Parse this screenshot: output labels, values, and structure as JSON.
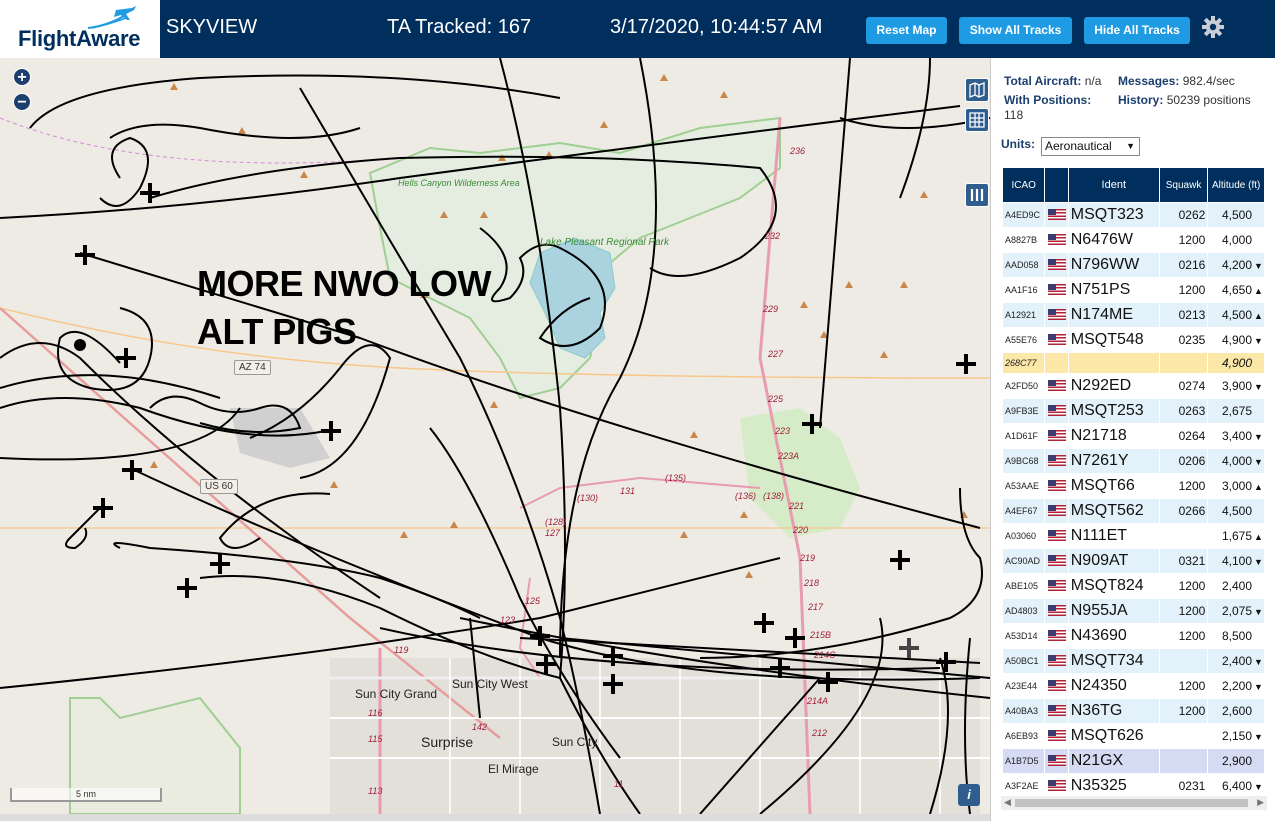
{
  "header": {
    "logo": "FlightAware",
    "title": "SKYVIEW",
    "tracked": "TA Tracked: 167",
    "datetime": "3/17/2020, 10:44:57 AM",
    "buttons": {
      "reset": "Reset Map",
      "show": "Show All Tracks",
      "hide": "Hide All Tracks"
    }
  },
  "map": {
    "annotation_line1": "MORE NWO LOW",
    "annotation_line2": "ALT PIGS",
    "scale": "5 nm",
    "labels": {
      "lake": "Lake Pleasant Regional Park",
      "wilderness": "Hells Canyon Wilderness Area",
      "az74": "AZ 74",
      "us60": "US 60",
      "sun_city_grand": "Sun City Grand",
      "sun_city_west": "Sun City West",
      "sun_city": "Sun City",
      "surprise": "Surprise",
      "el_mirage": "El Mirage"
    },
    "highway_numbers": [
      "236",
      "232",
      "229",
      "227",
      "225",
      "223",
      "223A",
      "221",
      "220",
      "219",
      "218",
      "217",
      "215B",
      "214A",
      "214C",
      "212",
      "(130)",
      "(135)",
      "(136)",
      "(138)",
      "(128)",
      "127",
      "125",
      "123",
      "131",
      "119",
      "116",
      "115",
      "113",
      "142",
      "11"
    ]
  },
  "panel": {
    "total_aircraft_label": "Total Aircraft:",
    "total_aircraft": "n/a",
    "messages_label": "Messages:",
    "messages": "982.4/sec",
    "with_positions_label": "With Positions:",
    "with_positions": "118",
    "history_label": "History:",
    "history": "50239 positions",
    "units_label": "Units:",
    "units_value": "Aeronautical",
    "columns": [
      "ICAO",
      "",
      "Ident",
      "Squawk",
      "Altitude (ft)"
    ],
    "rows": [
      {
        "icao": "A4ED9C",
        "ident": "MSQT323",
        "squawk": "0262",
        "alt": "4,500",
        "trend": ""
      },
      {
        "icao": "A8827B",
        "ident": "N6476W",
        "squawk": "1200",
        "alt": "4,000",
        "trend": ""
      },
      {
        "icao": "AAD058",
        "ident": "N796WW",
        "squawk": "0216",
        "alt": "4,200",
        "trend": "▼"
      },
      {
        "icao": "AA1F16",
        "ident": "N751PS",
        "squawk": "1200",
        "alt": "4,650",
        "trend": "▲"
      },
      {
        "icao": "A12921",
        "ident": "N174ME",
        "squawk": "0213",
        "alt": "4,500",
        "trend": "▲"
      },
      {
        "icao": "A55E76",
        "ident": "MSQT548",
        "squawk": "0235",
        "alt": "4,900",
        "trend": "▼"
      },
      {
        "icao": "268C77",
        "ident": "",
        "squawk": "",
        "alt": "4,900",
        "trend": ""
      },
      {
        "icao": "A2FD50",
        "ident": "N292ED",
        "squawk": "0274",
        "alt": "3,900",
        "trend": "▼"
      },
      {
        "icao": "A9FB3E",
        "ident": "MSQT253",
        "squawk": "0263",
        "alt": "2,675",
        "trend": ""
      },
      {
        "icao": "A1D61F",
        "ident": "N21718",
        "squawk": "0264",
        "alt": "3,400",
        "trend": "▼"
      },
      {
        "icao": "A9BC68",
        "ident": "N7261Y",
        "squawk": "0206",
        "alt": "4,000",
        "trend": "▼"
      },
      {
        "icao": "A53AAE",
        "ident": "MSQT66",
        "squawk": "1200",
        "alt": "3,000",
        "trend": "▲"
      },
      {
        "icao": "A4EF67",
        "ident": "MSQT562",
        "squawk": "0266",
        "alt": "4,500",
        "trend": ""
      },
      {
        "icao": "A03060",
        "ident": "N111ET",
        "squawk": "",
        "alt": "1,675",
        "trend": "▲"
      },
      {
        "icao": "AC90AD",
        "ident": "N909AT",
        "squawk": "0321",
        "alt": "4,100",
        "trend": "▼"
      },
      {
        "icao": "ABE105",
        "ident": "MSQT824",
        "squawk": "1200",
        "alt": "2,400",
        "trend": ""
      },
      {
        "icao": "AD4803",
        "ident": "N955JA",
        "squawk": "1200",
        "alt": "2,075",
        "trend": "▼"
      },
      {
        "icao": "A53D14",
        "ident": "N43690",
        "squawk": "1200",
        "alt": "8,500",
        "trend": ""
      },
      {
        "icao": "A50BC1",
        "ident": "MSQT734",
        "squawk": "",
        "alt": "2,400",
        "trend": "▼"
      },
      {
        "icao": "A23E44",
        "ident": "N24350",
        "squawk": "1200",
        "alt": "2,200",
        "trend": "▼"
      },
      {
        "icao": "A40BA3",
        "ident": "N36TG",
        "squawk": "1200",
        "alt": "2,600",
        "trend": ""
      },
      {
        "icao": "A6EB93",
        "ident": "MSQT626",
        "squawk": "",
        "alt": "2,150",
        "trend": "▼"
      },
      {
        "icao": "A1B7D5",
        "ident": "N21GX",
        "squawk": "",
        "alt": "2,900",
        "trend": ""
      },
      {
        "icao": "A3F2AE",
        "ident": "N35325",
        "squawk": "0231",
        "alt": "6,400",
        "trend": "▼"
      }
    ]
  },
  "colors": {
    "header_bg": "#002f5d",
    "button": "#1e9be3",
    "row_alt": "#e2f1fa",
    "highlight": "#fbe7a8",
    "selected": "#d6dbf4"
  }
}
